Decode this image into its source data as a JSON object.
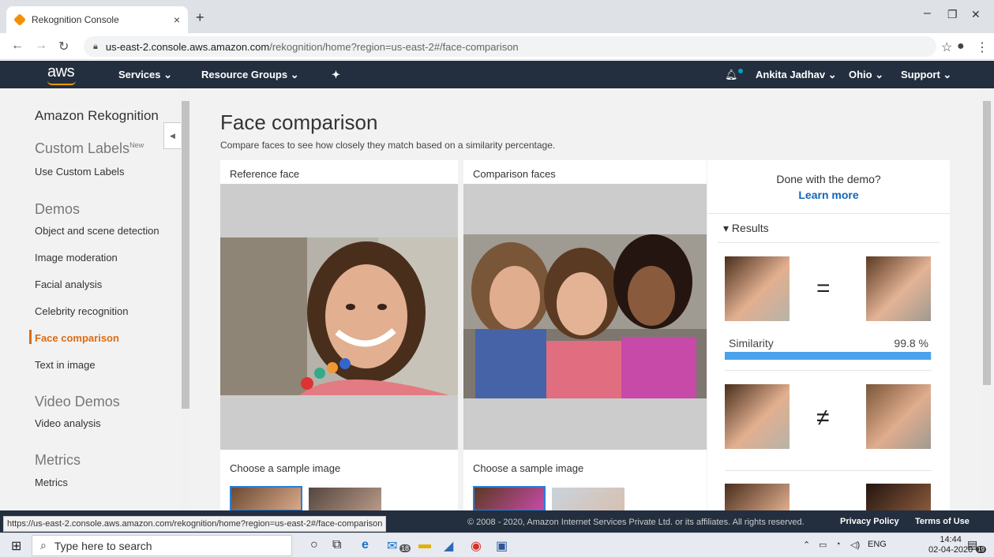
{
  "browser": {
    "tab_title": "Rekognition Console",
    "tab_close": "×",
    "new_tab": "+",
    "url_host": "us-east-2.console.aws.amazon.com",
    "url_path": "/rekognition/home?region=us-east-2#/face-comparison",
    "window_min": "–",
    "window_max": "❐",
    "window_close": "✕"
  },
  "aws_nav": {
    "logo": "aws",
    "services": "Services ⌄",
    "resource_groups": "Resource Groups ⌄",
    "pin": "✦",
    "bell": "♫",
    "user": "Ankita Jadhav ⌄",
    "region": "Ohio ⌄",
    "support": "Support ⌄"
  },
  "sidebar": {
    "title": "Amazon Rekognition",
    "custom_labels_section": "Custom Labels",
    "custom_labels_badge": "New",
    "use_custom_labels": "Use Custom Labels",
    "demos_section": "Demos",
    "demos": [
      "Object and scene detection",
      "Image moderation",
      "Facial analysis",
      "Celebrity recognition",
      "Face comparison",
      "Text in image"
    ],
    "video_section": "Video Demos",
    "video_analysis": "Video analysis",
    "metrics_section": "Metrics",
    "metrics": "Metrics",
    "collapse": "◀"
  },
  "main": {
    "title": "Face comparison",
    "subtitle": "Compare faces to see how closely they match based on a similarity percentage.",
    "reference_label": "Reference face",
    "comparison_label": "Comparison faces",
    "choose_reference": "Choose a sample image",
    "choose_comparison": "Choose a sample image"
  },
  "results": {
    "demo_question": "Done with the demo?",
    "learn_more": "Learn more",
    "header": "▾ Results",
    "match_op": "=",
    "nonmatch_op": "≠",
    "similarity_label": "Similarity",
    "similarity_value": "99.8 %",
    "similarity_fraction": 0.998
  },
  "footer": {
    "status_url": "https://us-east-2.console.aws.amazon.com/rekognition/home?region=us-east-2#/face-comparison",
    "copyright": "© 2008 - 2020, Amazon Internet Services Private Ltd. or its affiliates. All rights reserved.",
    "privacy": "Privacy Policy",
    "terms": "Terms of Use"
  },
  "taskbar": {
    "search_placeholder": "Type here to search",
    "lang": "ENG",
    "time": "14:44",
    "date": "02-04-2020",
    "mail_badge": "18",
    "notif_badge": "19"
  },
  "colors": {
    "aws_nav": "#232f3e",
    "accent_orange": "#dd6b10",
    "link_blue": "#1166bb",
    "bar_blue": "#4aa3ea"
  }
}
